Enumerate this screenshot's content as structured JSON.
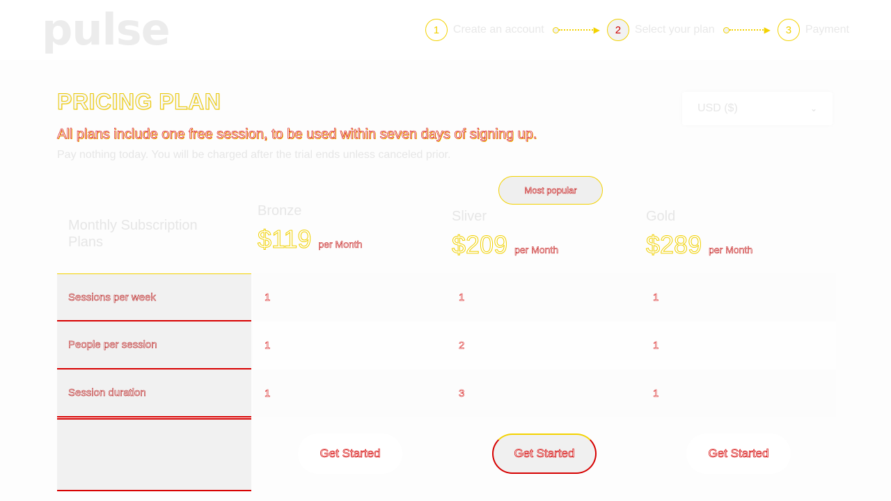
{
  "brand": {
    "logo_text": "pulse"
  },
  "stepper": {
    "steps": [
      {
        "number": "1",
        "label": "Create an account"
      },
      {
        "number": "2",
        "label": "Select your plan"
      },
      {
        "number": "3",
        "label": "Payment"
      }
    ]
  },
  "page": {
    "title": "PRICING PLAN",
    "subtitle": "All plans include one free session, to be used within seven days of signing up.",
    "note": "Pay nothing today. You will be charged after the trial ends unless canceled prior."
  },
  "currency_select": {
    "value": "USD ($)"
  },
  "badge": {
    "label": "Most popular"
  },
  "table": {
    "heading": "Monthly Subscription Plans",
    "rows": [
      "Sessions per week",
      "People per session",
      "Session duration"
    ],
    "plans": [
      {
        "name": "Bronze",
        "price": "$119",
        "period": "per Month",
        "values": [
          "1",
          "1",
          "1"
        ],
        "cta": "Get Started"
      },
      {
        "name": "Sliver",
        "price": "$209",
        "period": "per Month",
        "values": [
          "1",
          "2",
          "3"
        ],
        "cta": "Get Started"
      },
      {
        "name": "Gold",
        "price": "$289",
        "period": "per Month",
        "values": [
          "1",
          "1",
          "1"
        ],
        "cta": "Get Started"
      }
    ]
  },
  "colors": {
    "accent_yellow": "#f3d200",
    "accent_red": "#d60000"
  }
}
